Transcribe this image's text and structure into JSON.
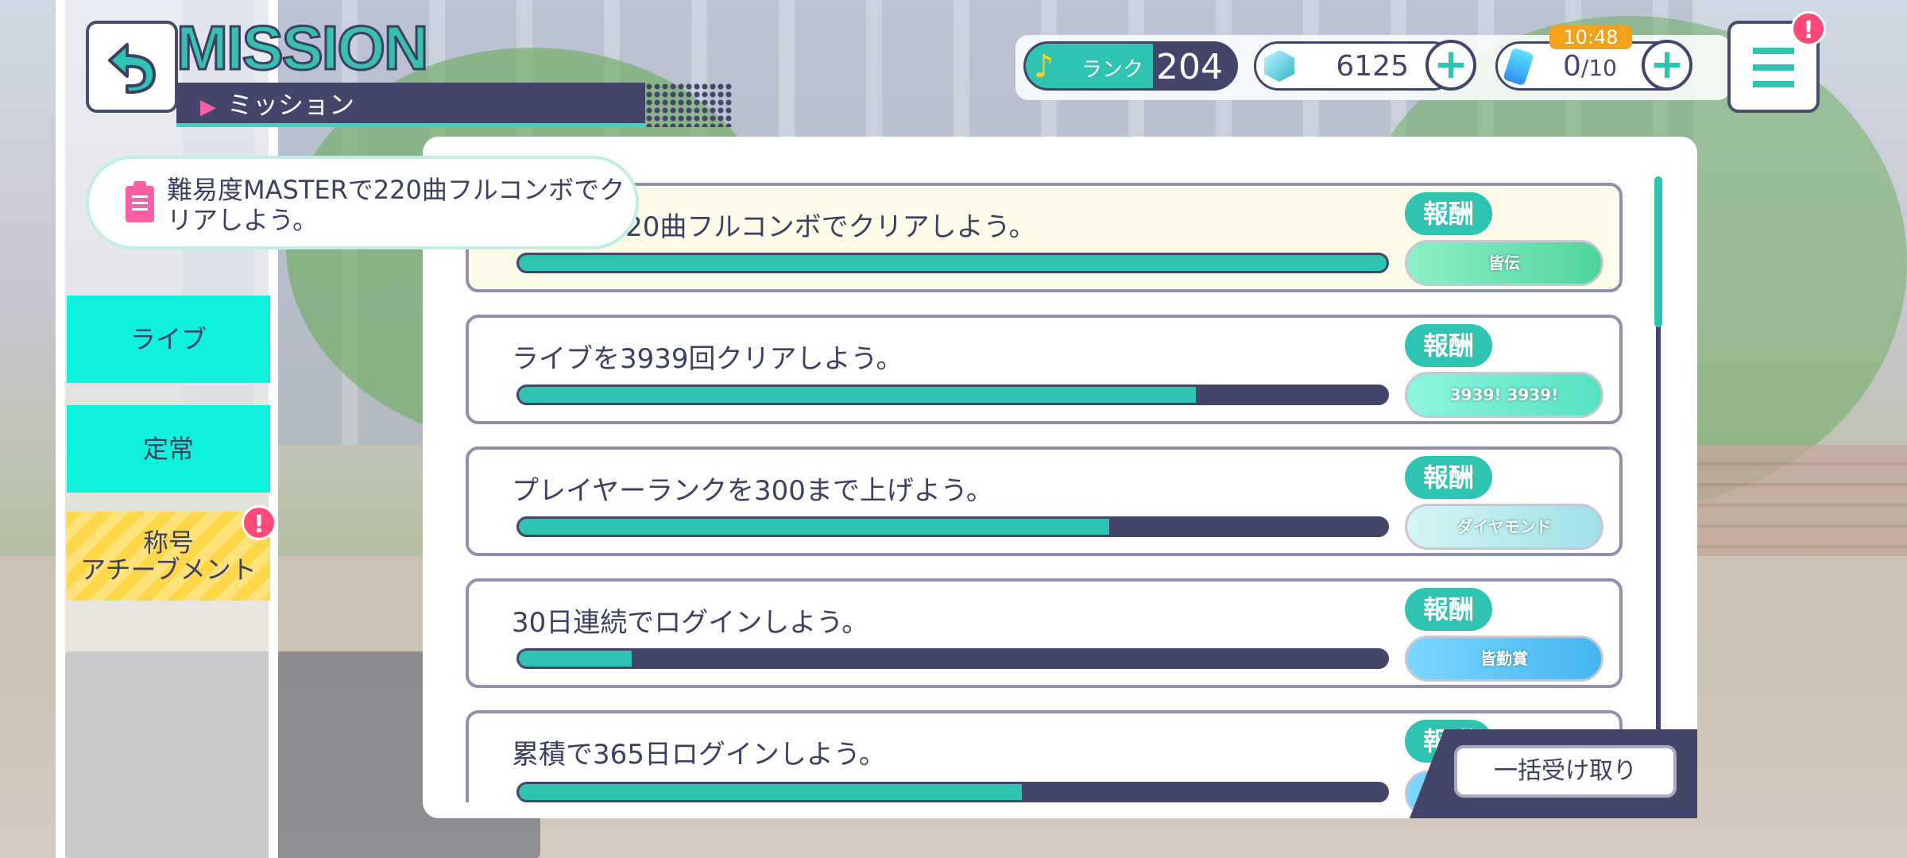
{
  "header": {
    "title": "MISSION",
    "subtitle": "ミッション"
  },
  "status": {
    "rank_label": "ランク",
    "rank_value": "204",
    "gems": "6125",
    "energy": "0/10",
    "energy_current": "0",
    "energy_max": "/10",
    "timer": "10:48",
    "menu_badge": "!"
  },
  "tooltip": {
    "text": "難易度MASTERで220曲フルコンボでクリアしよう。"
  },
  "tabs": [
    {
      "label": "ライブ"
    },
    {
      "label": "定常"
    },
    {
      "label_line1": "称号",
      "label_line2": "アチーブメント",
      "badge": "!"
    }
  ],
  "missions": [
    {
      "text": "STERで220曲フルコンボでクリアしよう。",
      "progress": 1.0,
      "reward_label": "報酬",
      "reward_name": "皆伝"
    },
    {
      "text": "ライブを3939回クリアしよう。",
      "progress": 0.78,
      "reward_label": "報酬",
      "reward_name": "3939!  3939!"
    },
    {
      "text": "プレイヤーランクを300まで上げよう。",
      "progress": 0.68,
      "reward_label": "報酬",
      "reward_name": "ダイヤモンド"
    },
    {
      "text": "30日連続でログインしよう。",
      "progress": 0.13,
      "reward_label": "報酬",
      "reward_name": "皆勤賞"
    },
    {
      "text": "累積で365日ログインしよう。",
      "progress": 0.58,
      "reward_label": "報酬",
      "reward_name": ""
    }
  ],
  "collect_all_label": "一括受け取り",
  "colors": {
    "accent": "#2fc3b1",
    "dark": "#43466a",
    "tab_cyan": "#10f1dc",
    "tab_yellow": "#ffd84a",
    "badge": "#ff4a78"
  }
}
